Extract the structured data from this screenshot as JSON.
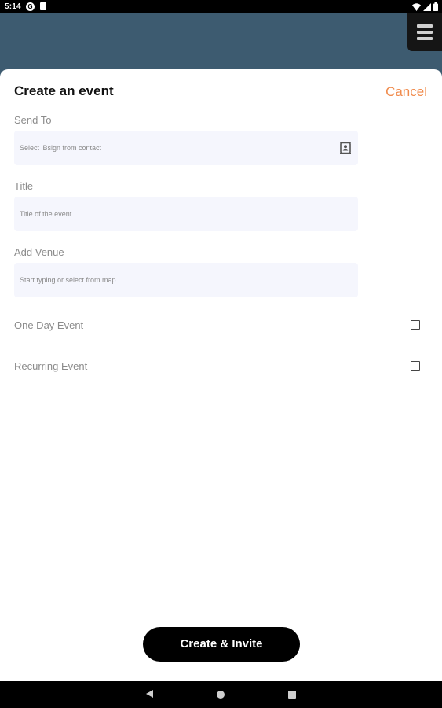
{
  "status_bar": {
    "time": "5:14",
    "notification_icons": [
      "g-icon",
      "sd-card-icon"
    ],
    "system_icons": [
      "wifi-icon",
      "signal-icon",
      "battery-icon"
    ]
  },
  "header": {
    "background_color": "#3d5b70",
    "menu_icon": "hamburger-menu-icon"
  },
  "sheet": {
    "title": "Create an event",
    "cancel_label": "Cancel",
    "accent_color": "#f08a4b",
    "fields": {
      "send_to": {
        "label": "Send To",
        "placeholder": "Select iBsign from contact",
        "value": "",
        "icon": "contacts-icon"
      },
      "title": {
        "label": "Title",
        "placeholder": "Title of the event",
        "value": ""
      },
      "venue": {
        "label": "Add Venue",
        "placeholder": "Start typing or select from map",
        "value": ""
      }
    },
    "options": {
      "one_day": {
        "label": "One Day Event",
        "checked": false
      },
      "recurring": {
        "label": "Recurring Event",
        "checked": false
      }
    },
    "submit_label": "Create & Invite"
  },
  "nav_bar": {
    "buttons": [
      "back-icon",
      "home-icon",
      "recents-icon"
    ]
  }
}
